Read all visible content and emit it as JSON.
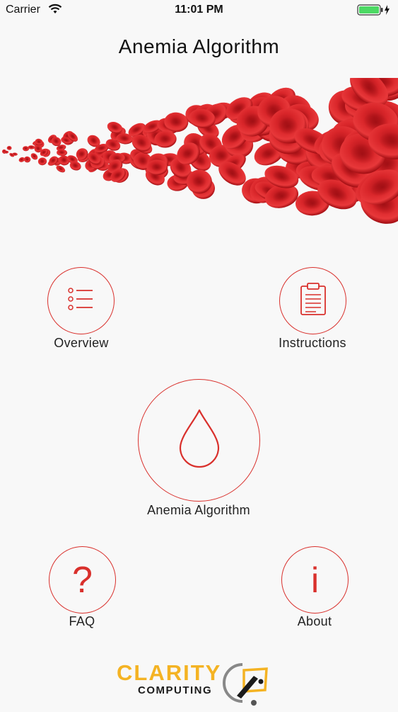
{
  "status_bar": {
    "carrier": "Carrier",
    "time": "11:01 PM",
    "battery_color": "#4cd964"
  },
  "header": {
    "title": "Anemia Algorithm"
  },
  "menu": {
    "overview": "Overview",
    "instructions": "Instructions",
    "algorithm": "Anemia Algorithm",
    "faq": "FAQ",
    "faq_glyph": "?",
    "about": "About",
    "about_glyph": "i"
  },
  "logo": {
    "line1": "CLARITY",
    "line2": "COMPUTING"
  },
  "colors": {
    "accent": "#d9302c",
    "logo_gold": "#f4b323",
    "background": "#f8f8f8"
  }
}
